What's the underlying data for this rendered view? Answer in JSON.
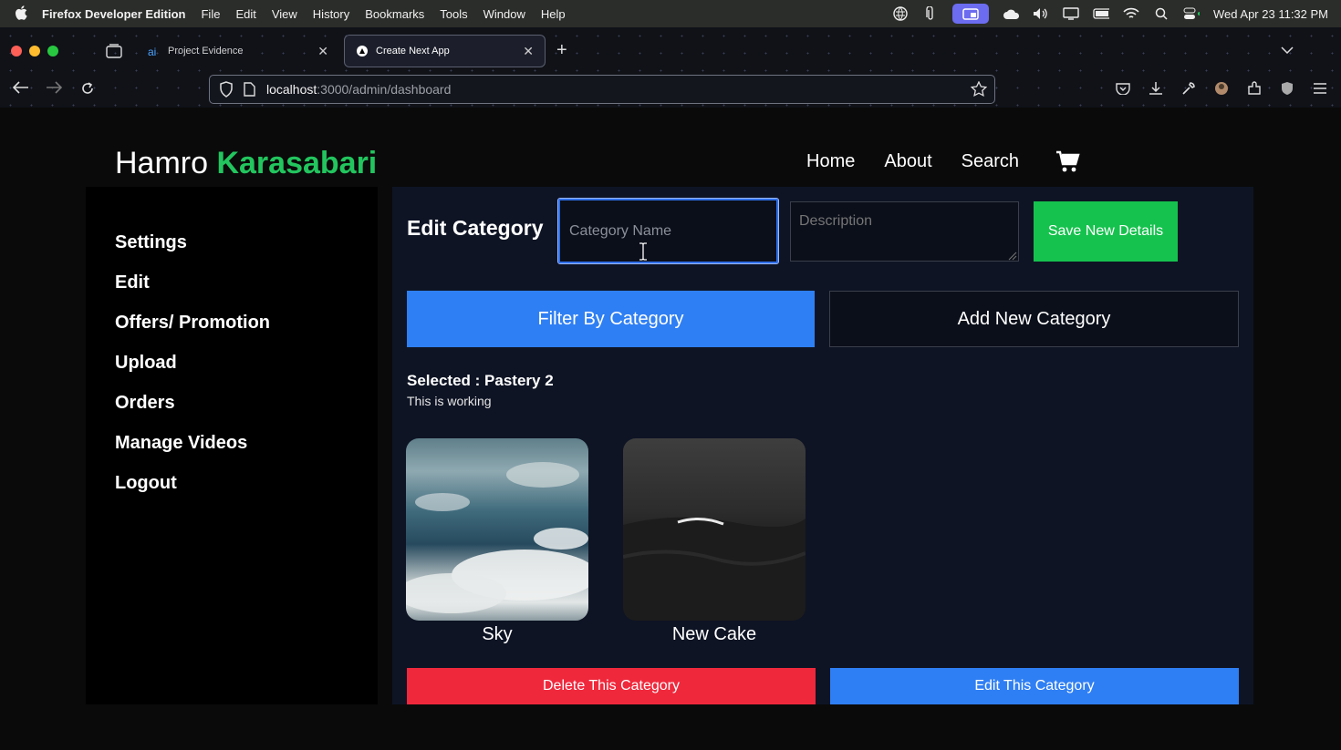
{
  "menubar": {
    "app_name": "Firefox Developer Edition",
    "items": [
      "File",
      "Edit",
      "View",
      "History",
      "Bookmarks",
      "Tools",
      "Window",
      "Help"
    ],
    "clock": "Wed Apr 23  11:32 PM"
  },
  "browser": {
    "tabs": [
      {
        "title": "Project Evidence",
        "active": false
      },
      {
        "title": "Create Next App",
        "active": true
      }
    ],
    "url_host": "localhost",
    "url_path": ":3000/admin/dashboard"
  },
  "site": {
    "logo_main": "Hamro ",
    "logo_accent": "Karasabari",
    "nav": [
      "Home",
      "About",
      "Search"
    ]
  },
  "sidebar": {
    "items": [
      "Settings",
      "Edit",
      "Offers/ Promotion",
      "Upload",
      "Orders",
      "Manage Videos",
      "Logout"
    ]
  },
  "editor": {
    "title": "Edit Category",
    "name_placeholder": "Category Name",
    "desc_placeholder": "Description",
    "save_label": "Save New Details",
    "filter_label": "Filter By Category",
    "add_label": "Add New Category",
    "selected_text": "Selected : Pastery 2",
    "selected_desc": "This is working",
    "cards": [
      {
        "label": "Sky"
      },
      {
        "label": "New Cake"
      }
    ],
    "delete_label": "Delete This Category",
    "edit_label": "Edit This Category"
  },
  "colors": {
    "accent_green": "#22c55e",
    "primary_blue": "#2f7ff4",
    "danger_red": "#f0283c",
    "save_green": "#16c24e"
  }
}
